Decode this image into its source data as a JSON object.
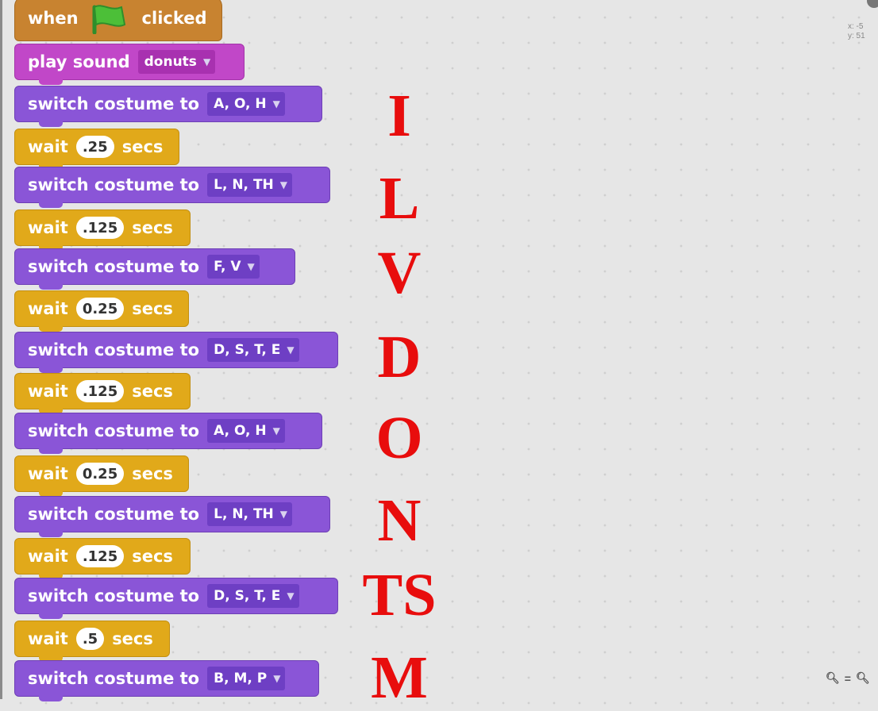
{
  "hat": {
    "left": "when",
    "right": "clicked"
  },
  "sound_block": {
    "label": "play sound",
    "value": "donuts"
  },
  "looks_label": "switch costume to",
  "wait_label": "wait",
  "secs_label": "secs",
  "costumes": [
    "A, O, H",
    "L, N, TH",
    "F, V",
    "D, S, T, E",
    "A, O, H",
    "L, N, TH",
    "D, S, T, E",
    "B, M, P"
  ],
  "waits": [
    ".25",
    ".125",
    "0.25",
    ".125",
    "0.25",
    ".125",
    ".5"
  ],
  "letters": [
    "I",
    "L",
    "V",
    "D",
    "O",
    "N",
    "TS",
    "M"
  ],
  "coords": {
    "x": "x: -5",
    "y": "y: 51"
  },
  "colors": {
    "events": "#c88330",
    "sound": "#c147c8",
    "looks": "#8a55d7",
    "control": "#e1a91a",
    "annotation": "#e80d0d"
  }
}
